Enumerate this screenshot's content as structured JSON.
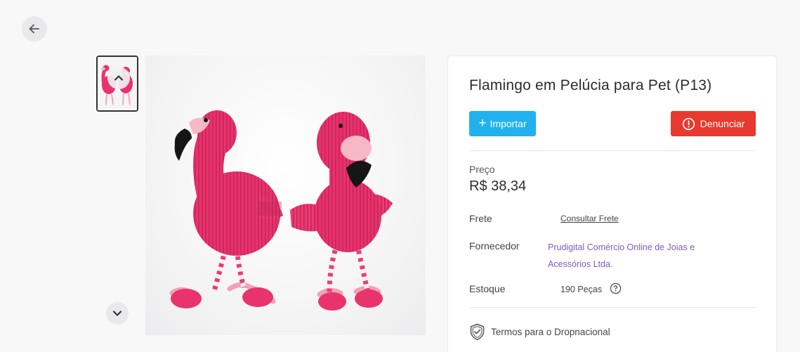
{
  "nav": {
    "back_icon": "arrow-left-icon"
  },
  "gallery": {
    "thumbnails": [
      {
        "alt": "flamingo-plush-thumbnail"
      }
    ],
    "up_icon": "chevron-up-icon",
    "down_icon": "chevron-down-icon"
  },
  "product": {
    "title": "Flamingo em Pelúcia para Pet (P13)",
    "import_label": "Importar",
    "report_label": "Denunciar",
    "price_label": "Preço",
    "price_value": "R$ 38,34",
    "freight_label": "Frete",
    "freight_link": "Consultar Frete",
    "supplier_label": "Fornecedor",
    "supplier_value": "Prudigital Comércio Online de Joias e Acessórios Ltda.",
    "stock_label": "Estoque",
    "stock_value": "190 Peças",
    "terms_label": "Termos para o Dropnacional"
  },
  "colors": {
    "import_button": "#22b1ef",
    "report_button": "#e7392e",
    "supplier_text": "#7a5cc4",
    "flamingo_pink": "#e8336d"
  }
}
